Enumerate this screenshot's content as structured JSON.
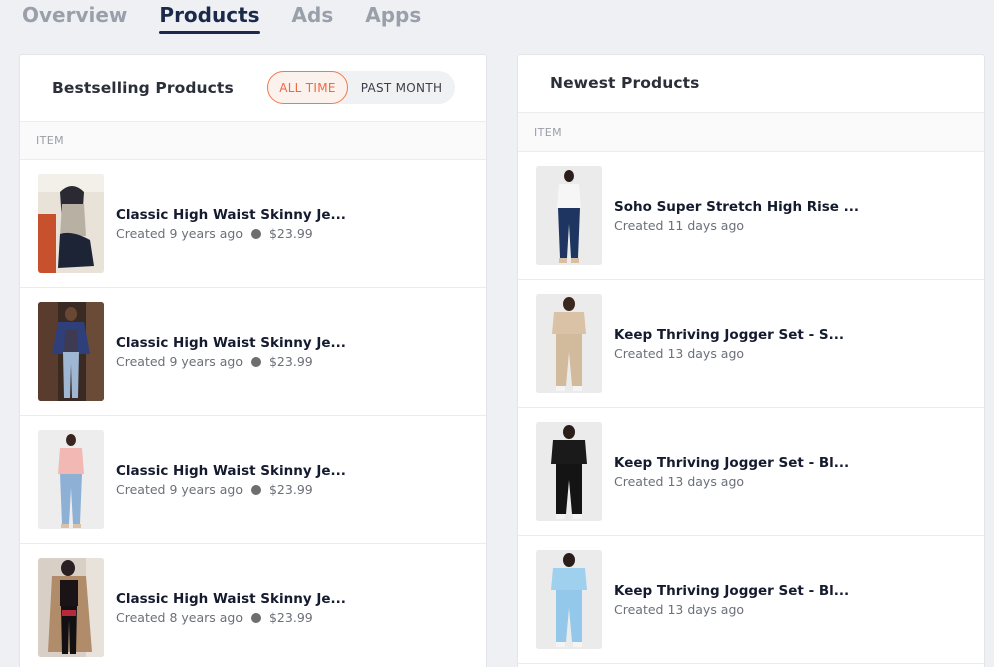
{
  "tabs": [
    {
      "label": "Overview",
      "active": false
    },
    {
      "label": "Products",
      "active": true
    },
    {
      "label": "Ads",
      "active": false
    },
    {
      "label": "Apps",
      "active": false
    }
  ],
  "bestselling": {
    "title": "Bestselling Products",
    "toggle": {
      "all_time": "ALL TIME",
      "past_month": "PAST MONTH",
      "selected": "ALL TIME"
    },
    "column_header": "ITEM",
    "items": [
      {
        "name": "Classic High Waist Skinny Je...",
        "created": "Created 9 years ago",
        "price": "$23.99",
        "thumb": "woman-seated-beige-top"
      },
      {
        "name": "Classic High Waist Skinny Je...",
        "created": "Created 9 years ago",
        "price": "$23.99",
        "thumb": "woman-blue-jacket-light-jeans"
      },
      {
        "name": "Classic High Waist Skinny Je...",
        "created": "Created 9 years ago",
        "price": "$23.99",
        "thumb": "woman-pink-top-light-jeans"
      },
      {
        "name": "Classic High Waist Skinny Je...",
        "created": "Created 8 years ago",
        "price": "$23.99",
        "thumb": "woman-camel-coat-black-jeans"
      }
    ]
  },
  "newest": {
    "title": "Newest Products",
    "column_header": "ITEM",
    "items": [
      {
        "name": "Soho Super Stretch High Rise ...",
        "created": "Created 11 days ago",
        "thumb": "woman-white-top-dark-jeans"
      },
      {
        "name": "Keep Thriving Jogger Set - S...",
        "created": "Created 13 days ago",
        "thumb": "woman-sand-jogger-set"
      },
      {
        "name": "Keep Thriving Jogger Set - Bl...",
        "created": "Created 13 days ago",
        "thumb": "woman-black-jogger-set"
      },
      {
        "name": "Keep Thriving Jogger Set - Bl...",
        "created": "Created 13 days ago",
        "thumb": "woman-light-blue-jogger-set"
      }
    ]
  },
  "colors": {
    "accent": "#ee6a3e",
    "tab_active": "#1b2a4a",
    "tab_inactive": "#9aa0aa"
  }
}
